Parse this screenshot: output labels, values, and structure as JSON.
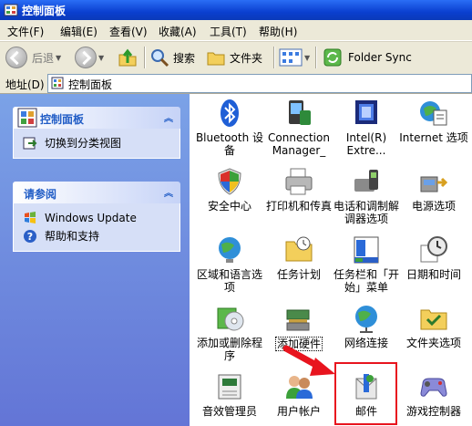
{
  "window": {
    "title": "控制面板"
  },
  "menu": [
    "文件(F)",
    "编辑(E)",
    "查看(V)",
    "收藏(A)",
    "工具(T)",
    "帮助(H)"
  ],
  "toolbar": {
    "back": "后退",
    "search": "搜索",
    "folders": "文件夹",
    "folder_sync": "Folder Sync"
  },
  "address": {
    "label": "地址(D)",
    "value": "控制面板"
  },
  "left_pane": {
    "control_panel": {
      "title": "控制面板",
      "switch_view": "切换到分类视图"
    },
    "see_also": {
      "title": "请参阅",
      "items": [
        "Windows Update",
        "帮助和支持"
      ]
    }
  },
  "items": [
    {
      "label": "Bluetooth 设备"
    },
    {
      "label": "Connection Manager_"
    },
    {
      "label": "Intel(R) Extre..."
    },
    {
      "label": "Internet 选项"
    },
    {
      "label": "安全中心"
    },
    {
      "label": "打印机和传真"
    },
    {
      "label": "电话和调制解调器选项"
    },
    {
      "label": "电源选项"
    },
    {
      "label": "区域和语言选项"
    },
    {
      "label": "任务计划"
    },
    {
      "label": "任务栏和「开始」菜单"
    },
    {
      "label": "日期和时间"
    },
    {
      "label": "添加或删除程序"
    },
    {
      "label": "添加硬件"
    },
    {
      "label": "网络连接"
    },
    {
      "label": "文件夹选项"
    },
    {
      "label": "音效管理员"
    },
    {
      "label": "用户帐户"
    },
    {
      "label": "邮件"
    },
    {
      "label": "游戏控制器"
    }
  ],
  "colors": {
    "titlebar": "#0a3fd0",
    "accent": "#215dc6",
    "highlight": "#e8141e"
  }
}
